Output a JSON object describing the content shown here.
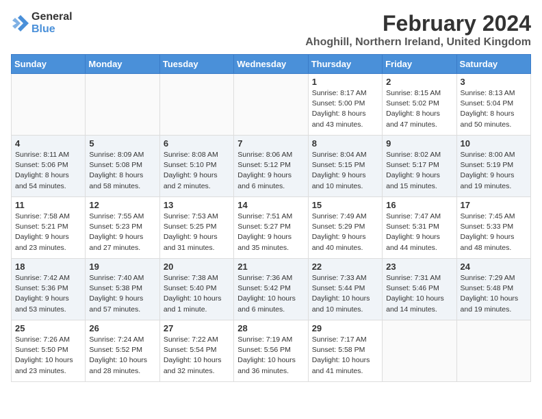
{
  "header": {
    "logo_general": "General",
    "logo_blue": "Blue",
    "month_title": "February 2024",
    "location": "Ahoghill, Northern Ireland, United Kingdom"
  },
  "weekdays": [
    "Sunday",
    "Monday",
    "Tuesday",
    "Wednesday",
    "Thursday",
    "Friday",
    "Saturday"
  ],
  "weeks": [
    [
      {
        "day": "",
        "info": ""
      },
      {
        "day": "",
        "info": ""
      },
      {
        "day": "",
        "info": ""
      },
      {
        "day": "",
        "info": ""
      },
      {
        "day": "1",
        "info": "Sunrise: 8:17 AM\nSunset: 5:00 PM\nDaylight: 8 hours\nand 43 minutes."
      },
      {
        "day": "2",
        "info": "Sunrise: 8:15 AM\nSunset: 5:02 PM\nDaylight: 8 hours\nand 47 minutes."
      },
      {
        "day": "3",
        "info": "Sunrise: 8:13 AM\nSunset: 5:04 PM\nDaylight: 8 hours\nand 50 minutes."
      }
    ],
    [
      {
        "day": "4",
        "info": "Sunrise: 8:11 AM\nSunset: 5:06 PM\nDaylight: 8 hours\nand 54 minutes."
      },
      {
        "day": "5",
        "info": "Sunrise: 8:09 AM\nSunset: 5:08 PM\nDaylight: 8 hours\nand 58 minutes."
      },
      {
        "day": "6",
        "info": "Sunrise: 8:08 AM\nSunset: 5:10 PM\nDaylight: 9 hours\nand 2 minutes."
      },
      {
        "day": "7",
        "info": "Sunrise: 8:06 AM\nSunset: 5:12 PM\nDaylight: 9 hours\nand 6 minutes."
      },
      {
        "day": "8",
        "info": "Sunrise: 8:04 AM\nSunset: 5:15 PM\nDaylight: 9 hours\nand 10 minutes."
      },
      {
        "day": "9",
        "info": "Sunrise: 8:02 AM\nSunset: 5:17 PM\nDaylight: 9 hours\nand 15 minutes."
      },
      {
        "day": "10",
        "info": "Sunrise: 8:00 AM\nSunset: 5:19 PM\nDaylight: 9 hours\nand 19 minutes."
      }
    ],
    [
      {
        "day": "11",
        "info": "Sunrise: 7:58 AM\nSunset: 5:21 PM\nDaylight: 9 hours\nand 23 minutes."
      },
      {
        "day": "12",
        "info": "Sunrise: 7:55 AM\nSunset: 5:23 PM\nDaylight: 9 hours\nand 27 minutes."
      },
      {
        "day": "13",
        "info": "Sunrise: 7:53 AM\nSunset: 5:25 PM\nDaylight: 9 hours\nand 31 minutes."
      },
      {
        "day": "14",
        "info": "Sunrise: 7:51 AM\nSunset: 5:27 PM\nDaylight: 9 hours\nand 35 minutes."
      },
      {
        "day": "15",
        "info": "Sunrise: 7:49 AM\nSunset: 5:29 PM\nDaylight: 9 hours\nand 40 minutes."
      },
      {
        "day": "16",
        "info": "Sunrise: 7:47 AM\nSunset: 5:31 PM\nDaylight: 9 hours\nand 44 minutes."
      },
      {
        "day": "17",
        "info": "Sunrise: 7:45 AM\nSunset: 5:33 PM\nDaylight: 9 hours\nand 48 minutes."
      }
    ],
    [
      {
        "day": "18",
        "info": "Sunrise: 7:42 AM\nSunset: 5:36 PM\nDaylight: 9 hours\nand 53 minutes."
      },
      {
        "day": "19",
        "info": "Sunrise: 7:40 AM\nSunset: 5:38 PM\nDaylight: 9 hours\nand 57 minutes."
      },
      {
        "day": "20",
        "info": "Sunrise: 7:38 AM\nSunset: 5:40 PM\nDaylight: 10 hours\nand 1 minute."
      },
      {
        "day": "21",
        "info": "Sunrise: 7:36 AM\nSunset: 5:42 PM\nDaylight: 10 hours\nand 6 minutes."
      },
      {
        "day": "22",
        "info": "Sunrise: 7:33 AM\nSunset: 5:44 PM\nDaylight: 10 hours\nand 10 minutes."
      },
      {
        "day": "23",
        "info": "Sunrise: 7:31 AM\nSunset: 5:46 PM\nDaylight: 10 hours\nand 14 minutes."
      },
      {
        "day": "24",
        "info": "Sunrise: 7:29 AM\nSunset: 5:48 PM\nDaylight: 10 hours\nand 19 minutes."
      }
    ],
    [
      {
        "day": "25",
        "info": "Sunrise: 7:26 AM\nSunset: 5:50 PM\nDaylight: 10 hours\nand 23 minutes."
      },
      {
        "day": "26",
        "info": "Sunrise: 7:24 AM\nSunset: 5:52 PM\nDaylight: 10 hours\nand 28 minutes."
      },
      {
        "day": "27",
        "info": "Sunrise: 7:22 AM\nSunset: 5:54 PM\nDaylight: 10 hours\nand 32 minutes."
      },
      {
        "day": "28",
        "info": "Sunrise: 7:19 AM\nSunset: 5:56 PM\nDaylight: 10 hours\nand 36 minutes."
      },
      {
        "day": "29",
        "info": "Sunrise: 7:17 AM\nSunset: 5:58 PM\nDaylight: 10 hours\nand 41 minutes."
      },
      {
        "day": "",
        "info": ""
      },
      {
        "day": "",
        "info": ""
      }
    ]
  ]
}
